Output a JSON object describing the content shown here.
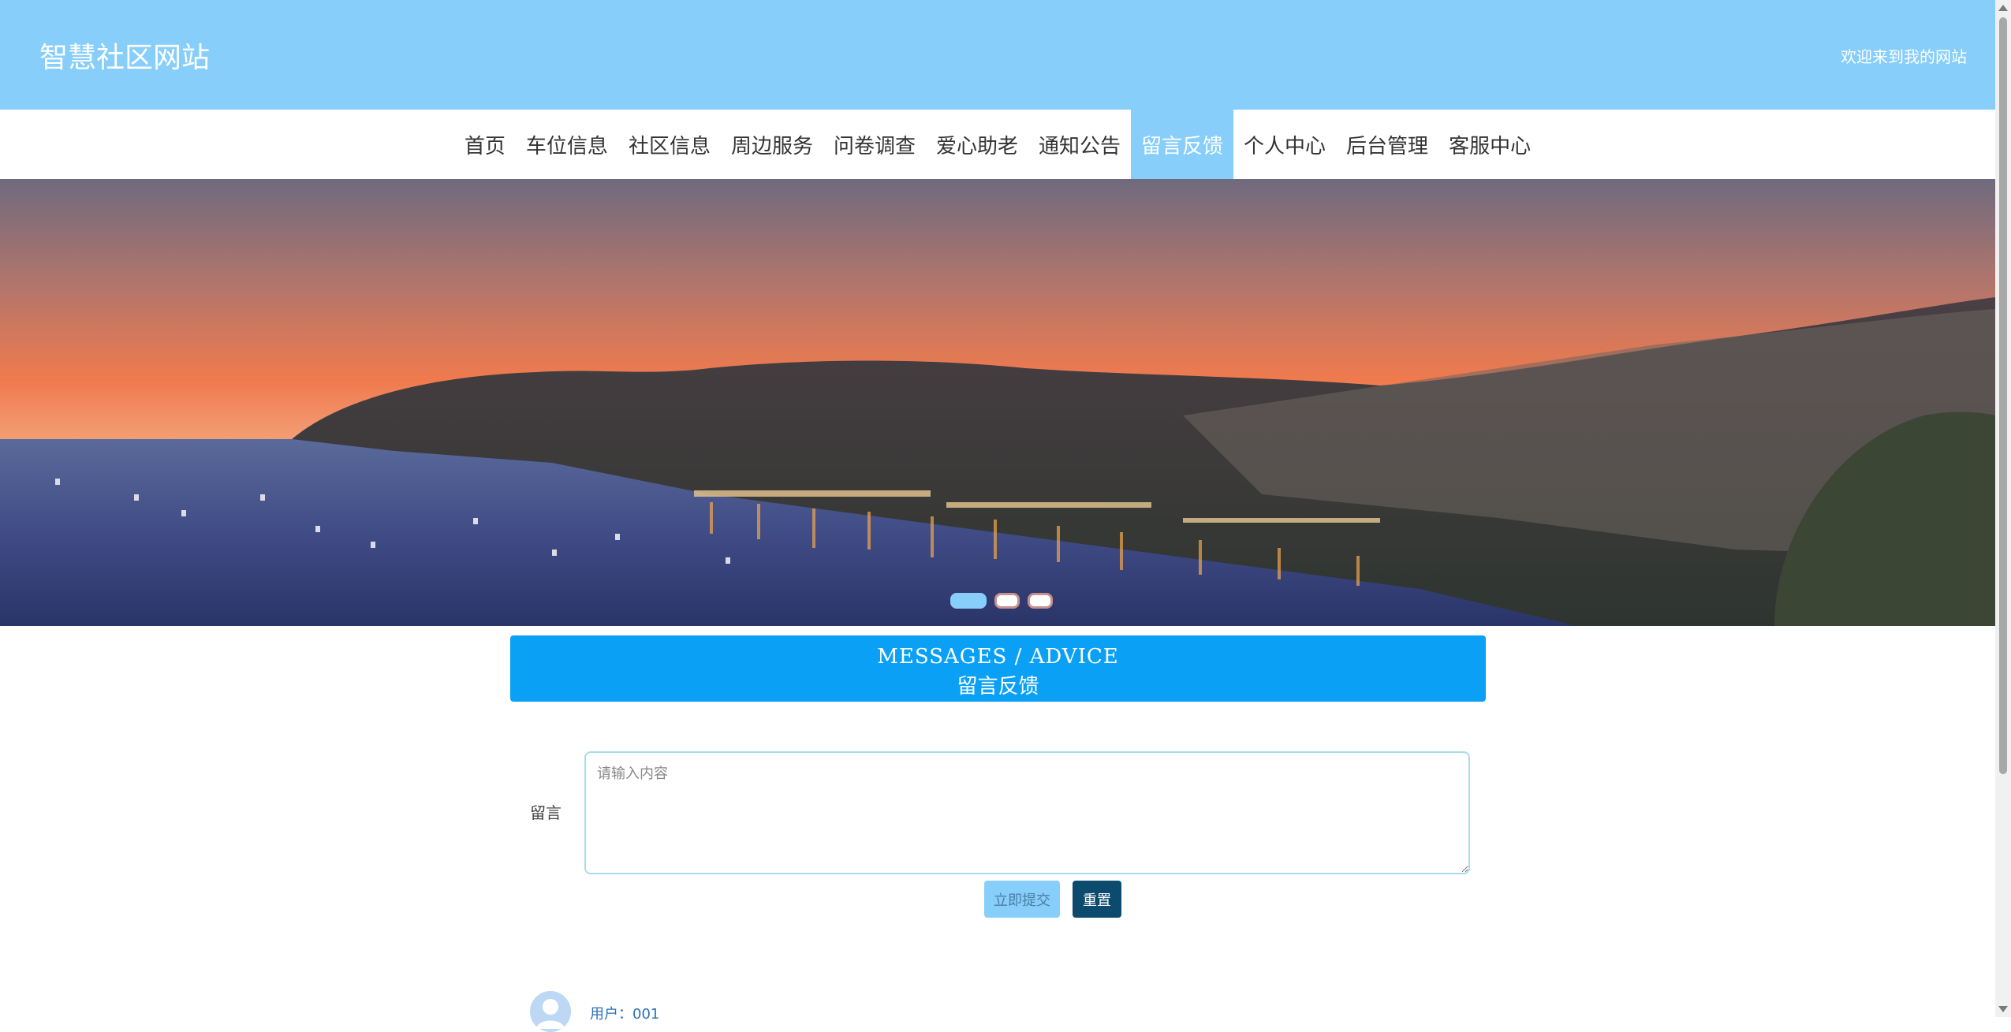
{
  "header": {
    "site_title": "智慧社区网站",
    "welcome": "欢迎来到我的网站"
  },
  "nav": {
    "items": [
      {
        "label": "首页"
      },
      {
        "label": "车位信息"
      },
      {
        "label": "社区信息"
      },
      {
        "label": "周边服务"
      },
      {
        "label": "问卷调查"
      },
      {
        "label": "爱心助老"
      },
      {
        "label": "通知公告"
      },
      {
        "label": "留言反馈",
        "active": true
      },
      {
        "label": "个人中心"
      },
      {
        "label": "后台管理"
      },
      {
        "label": "客服中心"
      }
    ]
  },
  "carousel": {
    "slide_count": 3,
    "active_index": 0
  },
  "section": {
    "title_en": "MESSAGES / ADVICE",
    "title_cn": "留言反馈"
  },
  "form": {
    "label": "留言",
    "placeholder": "请输入内容",
    "value": "",
    "submit_label": "立即提交",
    "reset_label": "重置"
  },
  "comments": [
    {
      "user": "用户：001"
    }
  ],
  "colors": {
    "header_bg": "#87cefa",
    "section_bg": "#0aa0f5",
    "reset_bg": "#0c4a6e"
  }
}
